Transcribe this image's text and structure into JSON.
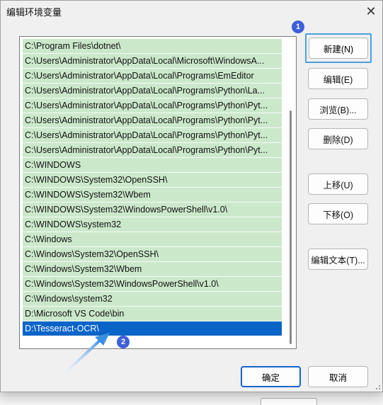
{
  "dialog": {
    "title": "编辑环境变量",
    "close_glyph": "✕"
  },
  "path_list": {
    "items": [
      "C:\\Program Files\\dotnet\\",
      "C:\\Users\\Administrator\\AppData\\Local\\Microsoft\\WindowsA...",
      "C:\\Users\\Administrator\\AppData\\Local\\Programs\\EmEditor",
      "C:\\Users\\Administrator\\AppData\\Local\\Programs\\Python\\La...",
      "C:\\Users\\Administrator\\AppData\\Local\\Programs\\Python\\Pyt...",
      "C:\\Users\\Administrator\\AppData\\Local\\Programs\\Python\\Pyt...",
      "C:\\Users\\Administrator\\AppData\\Local\\Programs\\Python\\Pyt...",
      "C:\\Users\\Administrator\\AppData\\Local\\Programs\\Python\\Pyt...",
      "C:\\WINDOWS",
      "C:\\WINDOWS\\System32\\OpenSSH\\",
      "C:\\WINDOWS\\System32\\Wbem",
      "C:\\WINDOWS\\System32\\WindowsPowerShell\\v1.0\\",
      "C:\\WINDOWS\\system32",
      "C:\\Windows",
      "C:\\Windows\\System32\\OpenSSH\\",
      "C:\\Windows\\System32\\Wbem",
      "C:\\Windows\\System32\\WindowsPowerShell\\v1.0\\",
      "C:\\Windows\\system32",
      "D:\\Microsoft VS Code\\bin",
      "D:\\Tesseract-OCR\\"
    ],
    "selected_index": 19
  },
  "buttons": {
    "new": "新建(N)",
    "edit": "编辑(E)",
    "browse": "浏览(B)...",
    "delete": "删除(D)",
    "move_up": "上移(U)",
    "move_down": "下移(O)",
    "edit_text": "编辑文本(T)...",
    "ok": "确定",
    "cancel": "取消"
  },
  "annotations": {
    "badge1": "1",
    "badge2": "2"
  },
  "colors": {
    "list_item_bg": "#cbe8cb",
    "selected_bg": "#0a64c8",
    "highlight_frame": "#4a9fe0",
    "badge": "#3d5fd9",
    "arrow": "#3a8fe0"
  }
}
